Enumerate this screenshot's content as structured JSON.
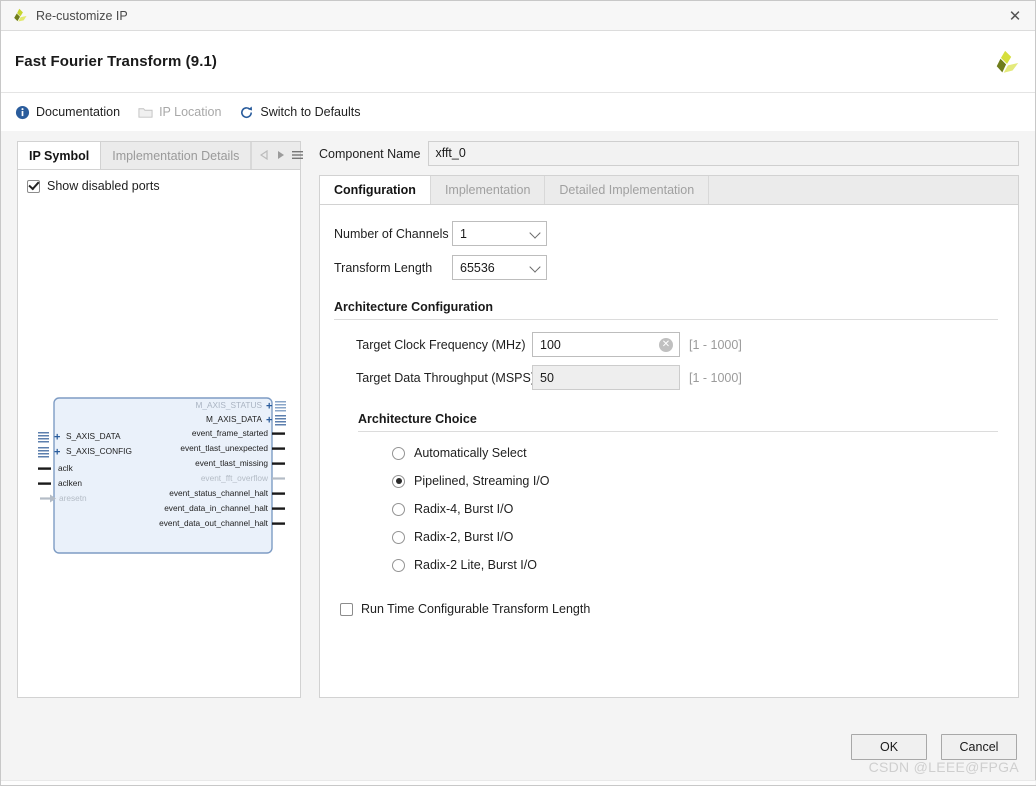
{
  "window": {
    "title": "Re-customize IP",
    "close_label": "✕",
    "logo_name": "xilinx-logo"
  },
  "header": {
    "title": "Fast Fourier Transform (9.1)"
  },
  "toolbar": {
    "items": [
      {
        "label": "Documentation",
        "icon": "info-icon",
        "disabled": false
      },
      {
        "label": "IP Location",
        "icon": "folder-icon",
        "disabled": true
      },
      {
        "label": "Switch to Defaults",
        "icon": "refresh-icon",
        "disabled": false
      }
    ]
  },
  "left_panel": {
    "tabs": [
      {
        "label": "IP Symbol",
        "active": true
      },
      {
        "label": "Implementation Details",
        "active": false
      }
    ],
    "nav": {
      "prev_icon": "triangle-left-icon",
      "next_icon": "triangle-right-icon",
      "menu_icon": "hamburger-menu-icon"
    },
    "show_disabled_ports": {
      "label": "Show disabled ports",
      "checked": true
    },
    "symbol": {
      "left_ports": [
        {
          "name": "S_AXIS_DATA",
          "type": "bus",
          "disabled": false
        },
        {
          "name": "S_AXIS_CONFIG",
          "type": "bus",
          "disabled": false
        },
        {
          "name": "aclk",
          "type": "pin",
          "disabled": false
        },
        {
          "name": "aclken",
          "type": "pin",
          "disabled": false
        },
        {
          "name": "aresetn",
          "type": "pin-inv",
          "disabled": true
        }
      ],
      "right_ports": [
        {
          "name": "M_AXIS_STATUS",
          "type": "bus",
          "disabled": true
        },
        {
          "name": "M_AXIS_DATA",
          "type": "bus",
          "disabled": false
        },
        {
          "name": "event_frame_started",
          "type": "pin",
          "disabled": false
        },
        {
          "name": "event_tlast_unexpected",
          "type": "pin",
          "disabled": false
        },
        {
          "name": "event_tlast_missing",
          "type": "pin",
          "disabled": false
        },
        {
          "name": "event_fft_overflow",
          "type": "pin",
          "disabled": true
        },
        {
          "name": "event_status_channel_halt",
          "type": "pin",
          "disabled": false
        },
        {
          "name": "event_data_in_channel_halt",
          "type": "pin",
          "disabled": false
        },
        {
          "name": "event_data_out_channel_halt",
          "type": "pin",
          "disabled": false
        }
      ]
    }
  },
  "right_panel": {
    "component_name": {
      "label": "Component Name",
      "value": "xfft_0"
    },
    "tabs": [
      {
        "label": "Configuration",
        "active": true
      },
      {
        "label": "Implementation",
        "active": false
      },
      {
        "label": "Detailed Implementation",
        "active": false
      }
    ],
    "fields": {
      "number_of_channels": {
        "label": "Number of Channels",
        "value": "1"
      },
      "transform_length": {
        "label": "Transform Length",
        "value": "65536"
      }
    },
    "architecture_configuration": {
      "title": "Architecture Configuration",
      "target_clock_frequency": {
        "label": "Target Clock Frequency (MHz)",
        "value": "100",
        "range": "[1 - 1000]",
        "disabled": false,
        "clear_icon": "clear-circle-icon"
      },
      "target_data_throughput": {
        "label": "Target Data Throughput (MSPS)",
        "value": "50",
        "range": "[1 - 1000]",
        "disabled": true
      }
    },
    "architecture_choice": {
      "title": "Architecture Choice",
      "options": [
        {
          "label": "Automatically Select",
          "selected": false
        },
        {
          "label": "Pipelined, Streaming I/O",
          "selected": true
        },
        {
          "label": "Radix-4, Burst I/O",
          "selected": false
        },
        {
          "label": "Radix-2, Burst I/O",
          "selected": false
        },
        {
          "label": "Radix-2 Lite, Burst I/O",
          "selected": false
        }
      ]
    },
    "run_time_configurable": {
      "label": "Run Time Configurable Transform Length",
      "checked": false
    }
  },
  "footer": {
    "ok_label": "OK",
    "cancel_label": "Cancel",
    "watermark": "CSDN @LEEE@FPGA"
  },
  "colors": {
    "accent_blue": "#2a5c9c",
    "logo_light": "#d6df3c",
    "logo_dark": "#6f7d1c",
    "symbol_fill": "#eaf1fa",
    "symbol_border": "#7e9cc4"
  }
}
